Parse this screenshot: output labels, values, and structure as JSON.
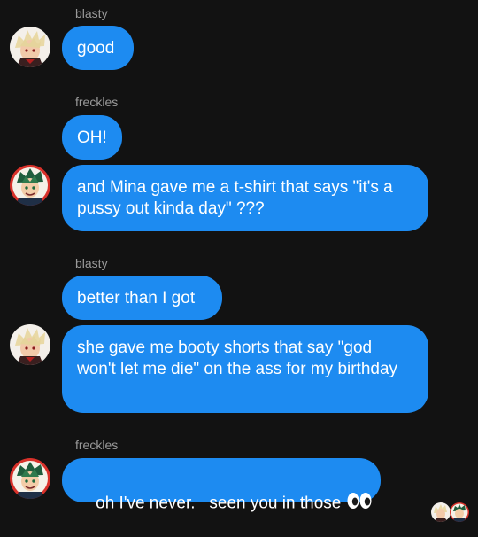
{
  "messages": [
    {
      "sender": "blasty",
      "text": "good",
      "avatar": "blonde-character-avatar"
    },
    {
      "sender": "freckles",
      "text": "OH!",
      "avatar": null
    },
    {
      "sender": null,
      "text": "and Mina gave me a t-shirt that says \"it's a pussy out kinda day\" ???",
      "avatar": "green-haired-character-avatar"
    },
    {
      "sender": "blasty",
      "text": "better than I got",
      "avatar": null
    },
    {
      "sender": null,
      "text": "she gave me booty shorts that say \"god won't let me die\" on the ass for my birthday",
      "avatar": "blonde-character-avatar"
    },
    {
      "sender": "freckles",
      "text": "oh I've never.   seen you in those",
      "emoji": "eyes-emoji",
      "avatar": "green-haired-character-avatar"
    }
  ],
  "colors": {
    "background": "#121212",
    "bubble": "#1d8bf1",
    "sender_name": "#9a9a9a"
  },
  "read_receipts": [
    "blonde-character-avatar",
    "green-haired-character-avatar"
  ]
}
